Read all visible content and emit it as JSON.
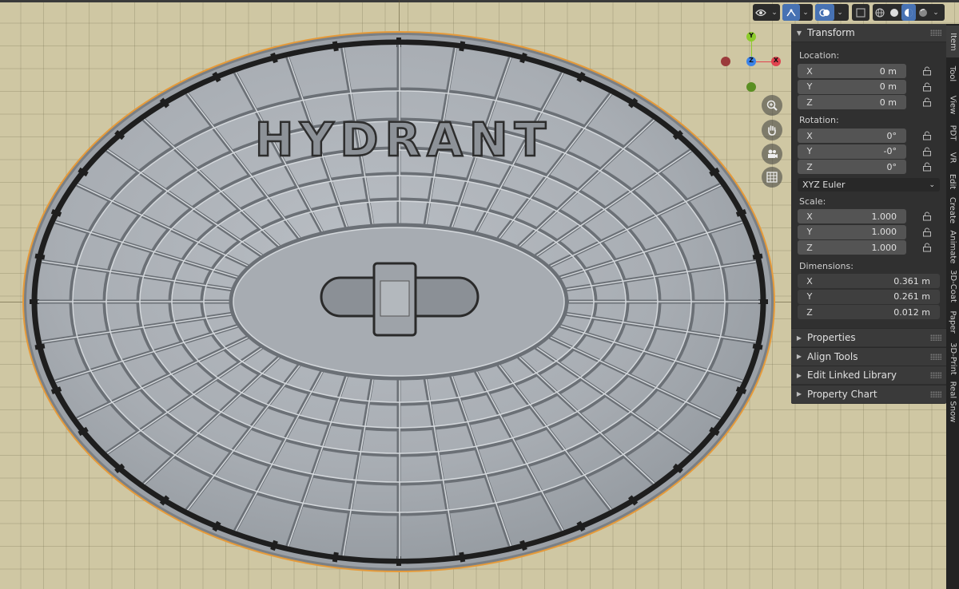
{
  "viewport": {
    "cover_text": "HYDRANT"
  },
  "header": {
    "buttons": [
      {
        "icon": "eye-visibility-icon"
      },
      {
        "icon": "gizmo-icon"
      },
      {
        "icon": "overlays-icon"
      },
      {
        "icon": "xray-icon"
      },
      {
        "icon": "wireframe-shading-icon"
      },
      {
        "icon": "solid-shading-icon"
      },
      {
        "icon": "material-shading-icon"
      },
      {
        "icon": "rendered-shading-icon"
      }
    ]
  },
  "gizmo": {
    "y_label": "Y",
    "x_label": "X",
    "z_label": "Z",
    "colors": {
      "x": "#e0434f",
      "y": "#8ccb2b",
      "z": "#3b83e8"
    }
  },
  "transform": {
    "title": "Transform",
    "location_label": "Location:",
    "location": [
      {
        "axis": "X",
        "value": "0 m"
      },
      {
        "axis": "Y",
        "value": "0 m"
      },
      {
        "axis": "Z",
        "value": "0 m"
      }
    ],
    "rotation_label": "Rotation:",
    "rotation": [
      {
        "axis": "X",
        "value": "0°"
      },
      {
        "axis": "Y",
        "value": "-0°"
      },
      {
        "axis": "Z",
        "value": "0°"
      }
    ],
    "rotation_mode": "XYZ Euler",
    "scale_label": "Scale:",
    "scale": [
      {
        "axis": "X",
        "value": "1.000"
      },
      {
        "axis": "Y",
        "value": "1.000"
      },
      {
        "axis": "Z",
        "value": "1.000"
      }
    ],
    "dimensions_label": "Dimensions:",
    "dimensions": [
      {
        "axis": "X",
        "value": "0.361 m"
      },
      {
        "axis": "Y",
        "value": "0.261 m"
      },
      {
        "axis": "Z",
        "value": "0.012 m"
      }
    ]
  },
  "panels": [
    {
      "title": "Properties"
    },
    {
      "title": "Align Tools"
    },
    {
      "title": "Edit Linked Library"
    },
    {
      "title": "Property Chart"
    }
  ],
  "tabs": [
    "Item",
    "Tool",
    "View",
    "PDT",
    "VR",
    "Edit",
    "Create",
    "Animate",
    "3D-Coat",
    "Paper",
    "3D-Print",
    "Real Snow"
  ]
}
